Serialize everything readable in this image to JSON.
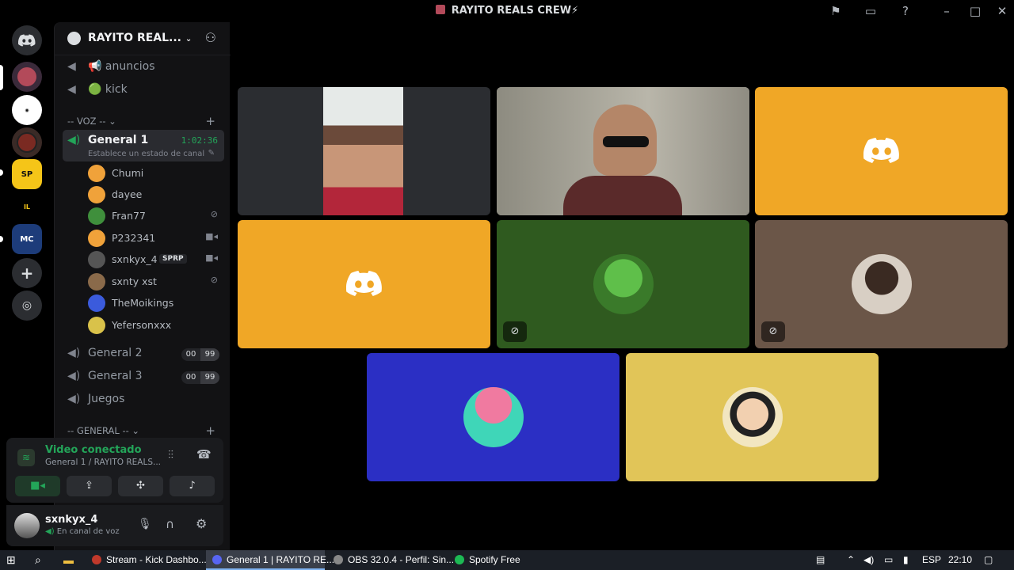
{
  "window": {
    "title": "RAYITO REALS CREW⚡"
  },
  "titlebar_icons": [
    "flag-icon",
    "inbox-icon",
    "help-icon",
    "minimize-icon",
    "maximize-icon",
    "close-icon"
  ],
  "server": {
    "name": "RAYITO REAL..."
  },
  "channels": {
    "text": [
      {
        "icon": "megaphone-icon",
        "label": "📢 anuncios"
      },
      {
        "icon": "megaphone-icon",
        "label": "🟢 kick"
      }
    ],
    "voice_category": "-- VOZ --",
    "current": {
      "name": "General 1",
      "timer": "1:02:36",
      "status": "Establece un estado de canal"
    },
    "members": [
      {
        "name": "Chumi",
        "status": "",
        "color": "#f0a23a"
      },
      {
        "name": "dayee",
        "status": "",
        "color": "#f0a23a"
      },
      {
        "name": "Fran77",
        "status": "muted-icon",
        "color": "#3f8f3c"
      },
      {
        "name": "P232341",
        "status": "camera-icon",
        "color": "#f0a23a"
      },
      {
        "name": "sxnkyx_4",
        "status": "camera-icon",
        "color": "#555",
        "tag": "SPRP"
      },
      {
        "name": "sxnty xst",
        "status": "muted-icon",
        "color": "#8a6a4a"
      },
      {
        "name": "TheMoikings",
        "status": "",
        "color": "#3b5bdc"
      },
      {
        "name": "Yefersonxxx",
        "status": "",
        "color": "#d9c24a"
      }
    ],
    "other_voice": [
      {
        "name": "General 2",
        "count": "00",
        "limit": "99"
      },
      {
        "name": "General 3",
        "count": "00",
        "limit": "99"
      },
      {
        "name": "Juegos",
        "count": "",
        "limit": ""
      }
    ],
    "general_category": "-- GENERAL --"
  },
  "voice_status": {
    "title": "Video conectado",
    "subtitle": "General 1 / RAYITO REALS..."
  },
  "user": {
    "name": "sxnkyx_4",
    "status": "En canal de voz"
  },
  "tiles": [
    {
      "type": "camera",
      "bg": "#2b2d31"
    },
    {
      "type": "camera",
      "bg": "#a8a69a"
    },
    {
      "type": "logo",
      "bg": "#f0a726"
    },
    {
      "type": "logo",
      "bg": "#f0a726"
    },
    {
      "type": "avatar",
      "bg": "#2f5a1f",
      "muted": true
    },
    {
      "type": "avatar",
      "bg": "#6b5648",
      "muted": true
    },
    {
      "type": "avatar",
      "bg": "#2b2fc4"
    },
    {
      "type": "avatar",
      "bg": "#e1c558"
    }
  ],
  "taskbar": {
    "items": [
      {
        "label": "Stream - Kick Dashbo...",
        "color": "#c0392b"
      },
      {
        "label": "General 1 | RAYITO RE...",
        "color": "#5865f2"
      },
      {
        "label": "OBS 32.0.4 - Perfil: Sin...",
        "color": "#888"
      },
      {
        "label": "Spotify Free",
        "color": "#1db954"
      }
    ],
    "language": "ESP",
    "clock": "22:10"
  }
}
